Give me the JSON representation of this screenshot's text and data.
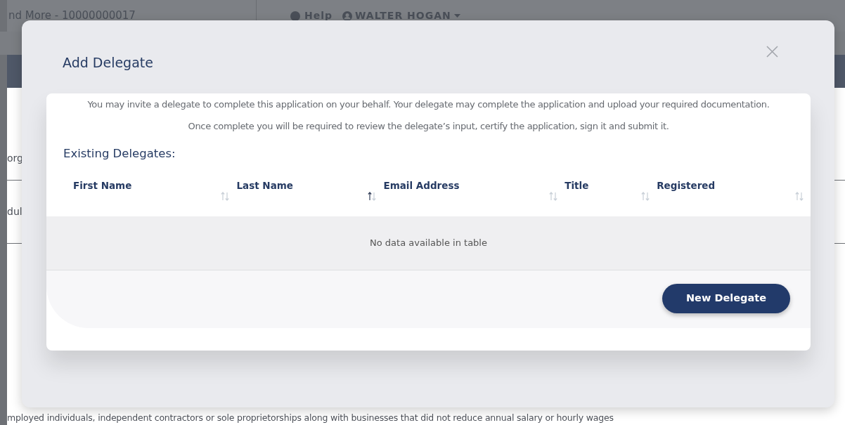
{
  "background": {
    "header_title": "nd More - 10000000017",
    "help_link": "Help",
    "user_menu": "WALTER HOGAN",
    "side_text_1": "org",
    "side_text_2": "dul",
    "bottom_text": "mployed individuals, independent contractors or sole proprietorships along with businesses that did not reduce annual salary or hourly wages"
  },
  "modal": {
    "title": "Add Delegate",
    "intro": [
      "You may invite a delegate to complete this application on your behalf. Your delegate may complete the application and upload your required documentation.",
      "Once complete you will be required to review the delegate’s input, certify the application, sign it and submit it."
    ],
    "section_title": "Existing Delegates:",
    "table": {
      "columns": [
        {
          "label": "First Name",
          "sorted": false
        },
        {
          "label": "Last Name",
          "sorted": true
        },
        {
          "label": "Email Address",
          "sorted": false
        },
        {
          "label": "Title",
          "sorted": false
        },
        {
          "label": "Registered",
          "sorted": false
        }
      ],
      "empty_message": "No data available in table"
    },
    "button": "New Delegate"
  }
}
